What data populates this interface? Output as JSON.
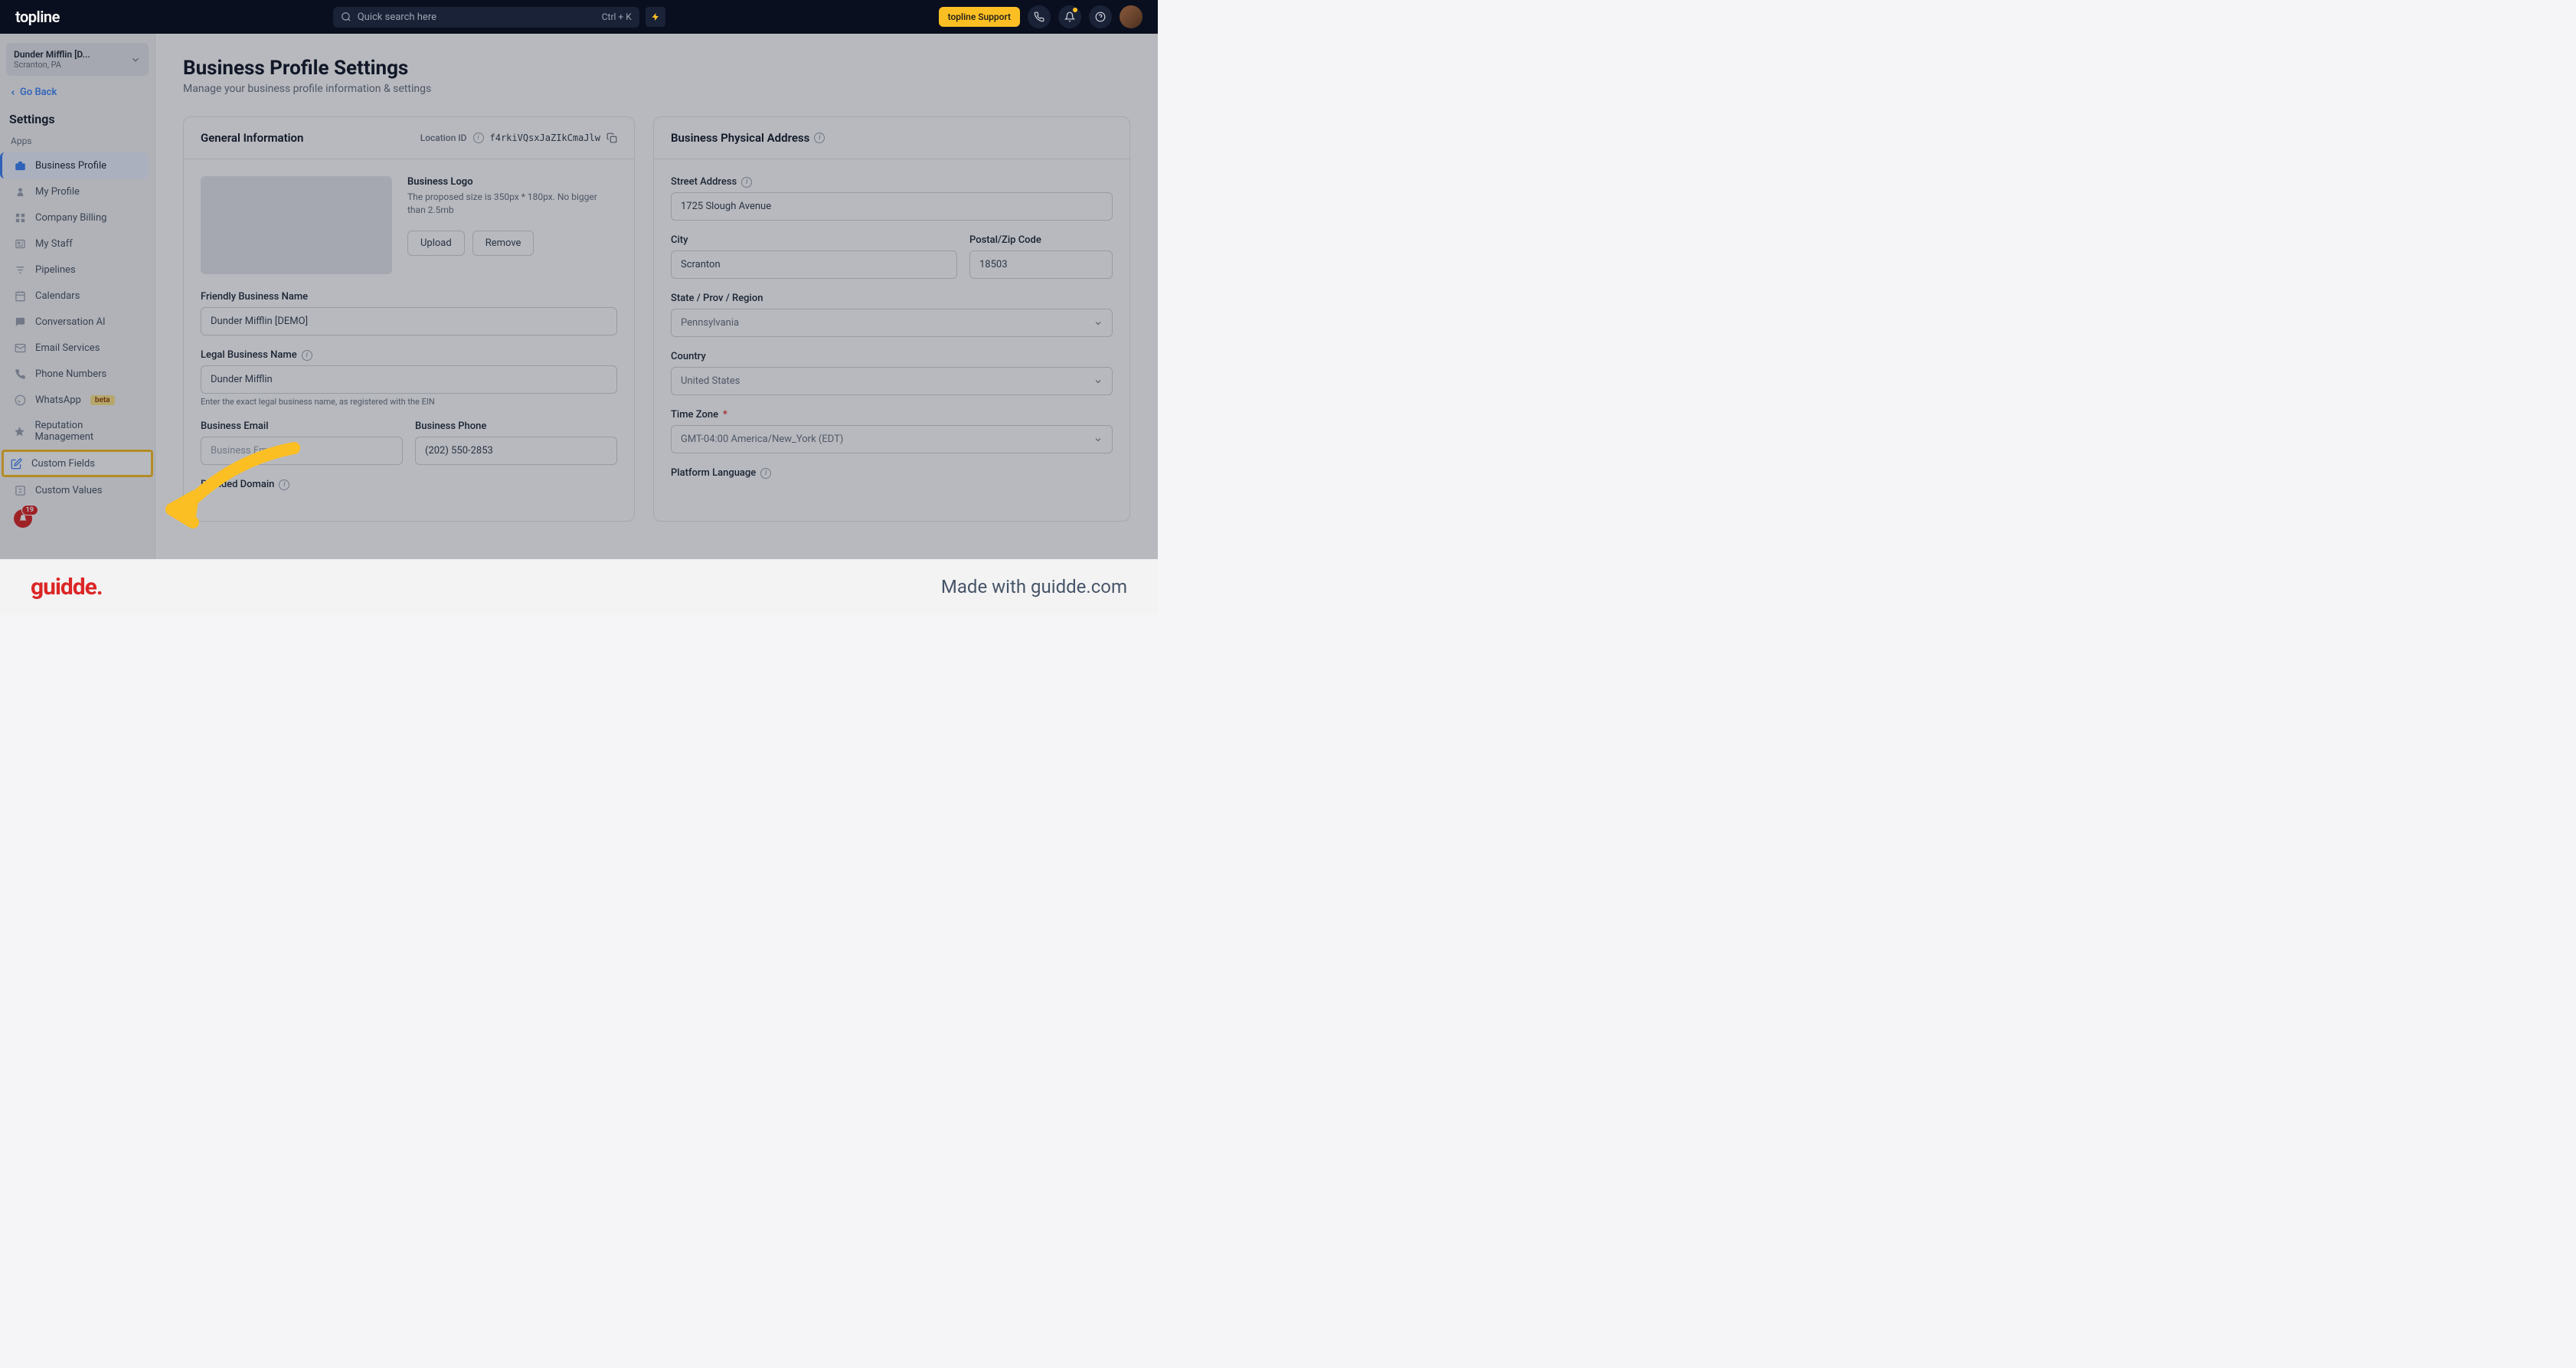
{
  "header": {
    "logo": "topline",
    "search_placeholder": "Quick search here",
    "shortcut": "Ctrl + K",
    "support_label": "topline Support"
  },
  "workspace": {
    "name": "Dunder Mifflin [D...",
    "location": "Scranton, PA"
  },
  "sidebar": {
    "go_back": "Go Back",
    "settings_label": "Settings",
    "section_label": "Apps",
    "items": [
      "Business Profile",
      "My Profile",
      "Company Billing",
      "My Staff",
      "Pipelines",
      "Calendars",
      "Conversation AI",
      "Email Services",
      "Phone Numbers",
      "WhatsApp",
      "Reputation Management",
      "Custom Fields",
      "Custom Values"
    ],
    "beta_label": "beta",
    "notif_count": "19"
  },
  "page": {
    "title": "Business Profile Settings",
    "subtitle": "Manage your business profile information & settings"
  },
  "general": {
    "panel_title": "General Information",
    "location_id_label": "Location ID",
    "location_id_value": "f4rkiVQsxJaZIkCmaJlw",
    "logo_label": "Business Logo",
    "logo_hint": "The proposed size is 350px * 180px. No bigger than 2.5mb",
    "upload_btn": "Upload",
    "remove_btn": "Remove",
    "friendly_name_label": "Friendly Business Name",
    "friendly_name_value": "Dunder Mifflin [DEMO]",
    "legal_name_label": "Legal Business Name",
    "legal_name_value": "Dunder Mifflin",
    "legal_name_helper": "Enter the exact legal business name, as registered with the EIN",
    "email_label": "Business Email",
    "email_placeholder": "Business Email",
    "phone_label": "Business Phone",
    "phone_value": "(202) 550-2853",
    "branded_domain_label": "Branded Domain"
  },
  "address": {
    "panel_title": "Business Physical Address",
    "street_label": "Street Address",
    "street_value": "1725 Slough Avenue",
    "city_label": "City",
    "city_value": "Scranton",
    "postal_label": "Postal/Zip Code",
    "postal_value": "18503",
    "state_label": "State / Prov / Region",
    "state_value": "Pennsylvania",
    "country_label": "Country",
    "country_value": "United States",
    "timezone_label": "Time Zone",
    "timezone_value": "GMT-04:00 America/New_York (EDT)",
    "platform_lang_label": "Platform Language"
  },
  "watermark": {
    "logo": "guidde.",
    "text": "Made with guidde.com"
  }
}
